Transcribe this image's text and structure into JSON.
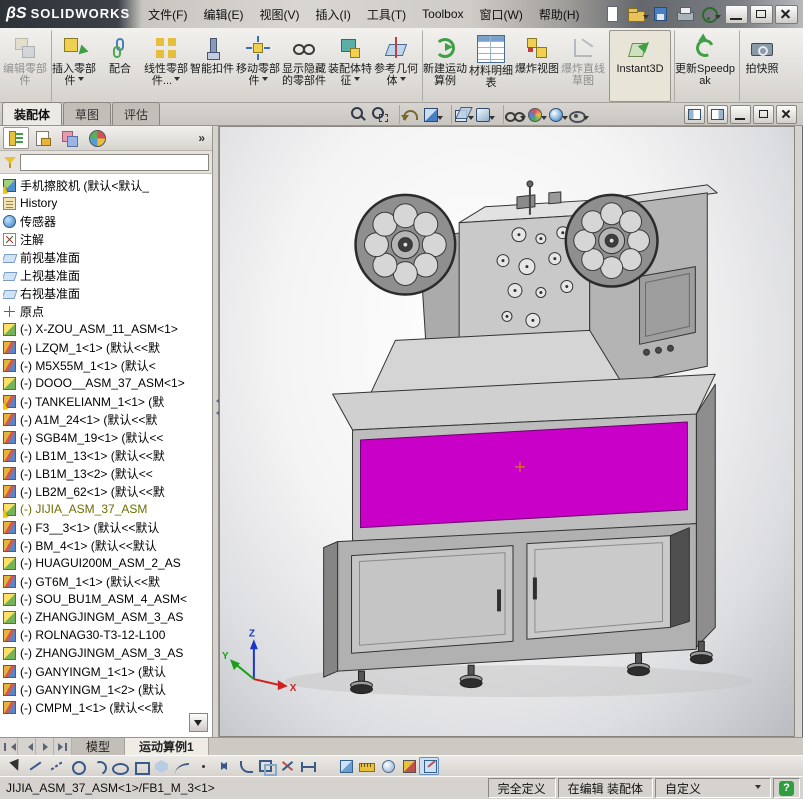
{
  "titlebar": {
    "logo_mark": "βS",
    "logo_text": "SOLIDWORKS",
    "menu": [
      {
        "label": "文件(F)"
      },
      {
        "label": "编辑(E)"
      },
      {
        "label": "视图(V)"
      },
      {
        "label": "插入(I)"
      },
      {
        "label": "工具(T)"
      },
      {
        "label": "Toolbox"
      },
      {
        "label": "窗口(W)"
      },
      {
        "label": "帮助(H)"
      }
    ],
    "quick_icons": [
      {
        "icon": "new-document"
      },
      {
        "icon": "open-document",
        "dd": true
      },
      {
        "icon": "save-document"
      },
      {
        "icon": "print-document"
      },
      {
        "icon": "help",
        "dd": true
      }
    ],
    "window_controls": [
      {
        "icon": "win-minimize"
      },
      {
        "icon": "win-restore"
      },
      {
        "icon": "win-close"
      }
    ]
  },
  "toolbar": {
    "buttons": [
      {
        "label": "编辑零部件",
        "icon": "edit-component",
        "disabled": true
      },
      {
        "label": "插入零部件",
        "icon": "insert-component",
        "dropdown": true,
        "sep": true
      },
      {
        "label": "配合",
        "icon": "mate"
      },
      {
        "label": "线性零部件...",
        "icon": "linear-pattern",
        "dropdown": true
      },
      {
        "label": "智能扣件",
        "icon": "smart-fasteners"
      },
      {
        "label": "移动零部件",
        "icon": "move-component",
        "dropdown": true
      },
      {
        "label": "显示隐藏的零部件",
        "icon": "show-hidden"
      },
      {
        "label": "装配体特征",
        "icon": "assembly-features",
        "dropdown": true
      },
      {
        "label": "参考几何体",
        "icon": "reference-geometry",
        "dropdown": true
      },
      {
        "label": "新建运动算例",
        "icon": "motion-study",
        "sep": true
      },
      {
        "label": "材料明细表",
        "icon": "bom"
      },
      {
        "label": "爆炸视图",
        "icon": "exploded-view"
      },
      {
        "label": "爆炸直线草图",
        "icon": "explode-sketch",
        "disabled": true
      },
      {
        "label": "Instant3D",
        "icon": "instant3d",
        "pressed": true,
        "sep": true,
        "wide": true
      },
      {
        "label": "更新Speedpak",
        "icon": "speedpak",
        "sep": true,
        "wide": true
      },
      {
        "label": "拍快照",
        "icon": "snapshot",
        "sep": true
      }
    ]
  },
  "command_tabs": [
    {
      "label": "装配体",
      "active": true
    },
    {
      "label": "草图"
    },
    {
      "label": "评估"
    }
  ],
  "viewbar": [
    {
      "icon": "zoom-fit"
    },
    {
      "icon": "zoom-area"
    },
    {
      "icon": "previous-view",
      "sep": true
    },
    {
      "icon": "section-view",
      "dd": true
    },
    {
      "icon": "view-orientation",
      "dd": true,
      "sep": true
    },
    {
      "icon": "display-style",
      "dd": true
    },
    {
      "icon": "hide-show",
      "dd": true,
      "sep": true
    },
    {
      "icon": "edit-appearance",
      "dd": true
    },
    {
      "icon": "apply-scene",
      "dd": true
    },
    {
      "icon": "view-settings",
      "dd": true
    }
  ],
  "doc_controls": [
    {
      "icon": "pane-left"
    },
    {
      "icon": "pane-right"
    },
    {
      "icon": "doc-minimize"
    },
    {
      "icon": "doc-restore"
    },
    {
      "icon": "doc-close"
    }
  ],
  "panel": {
    "tabs": [
      {
        "icon": "feature-manager",
        "active": true
      },
      {
        "icon": "property-manager"
      },
      {
        "icon": "configuration-manager"
      },
      {
        "icon": "display-manager"
      }
    ],
    "overflow": "»",
    "tree": [
      {
        "icon": "assembly-root",
        "warn": true,
        "label": "手机擦胶机 (默认<默认_"
      },
      {
        "icon": "history",
        "label": "History"
      },
      {
        "icon": "sensors",
        "label": "传感器"
      },
      {
        "icon": "annotations",
        "label": "注解"
      },
      {
        "icon": "plane",
        "label": "前视基准面"
      },
      {
        "icon": "plane",
        "label": "上视基准面"
      },
      {
        "icon": "plane",
        "label": "右视基准面"
      },
      {
        "icon": "origin",
        "label": "原点"
      },
      {
        "icon": "assembly",
        "label": "(-) X-ZOU_ASM_11_ASM<1>"
      },
      {
        "icon": "part",
        "label": "(-) LZQM_1<1> (默认<<默"
      },
      {
        "icon": "part",
        "label": "(-) M5X55M_1<1> (默认<"
      },
      {
        "icon": "assembly",
        "label": "(-) DOOO__ASM_37_ASM<1>"
      },
      {
        "icon": "part",
        "warn": true,
        "label": "(-) TANKELIANM_1<1> (默"
      },
      {
        "icon": "part",
        "label": "(-) A1M_24<1> (默认<<默"
      },
      {
        "icon": "part",
        "label": "(-) SGB4M_19<1> (默认<<"
      },
      {
        "icon": "part",
        "label": "(-) LB1M_13<1> (默认<<默"
      },
      {
        "icon": "part",
        "label": "(-) LB1M_13<2> (默认<<"
      },
      {
        "icon": "part",
        "label": "(-) LB2M_62<1> (默认<<默"
      },
      {
        "icon": "assembly",
        "warn": true,
        "edited": true,
        "label": "(-) JIJIA_ASM_37_ASM"
      },
      {
        "icon": "part",
        "label": "(-) F3__3<1> (默认<<默认"
      },
      {
        "icon": "part",
        "label": "(-) BM_4<1> (默认<<默认"
      },
      {
        "icon": "assembly",
        "label": "(-) HUAGUI200M_ASM_2_AS"
      },
      {
        "icon": "part",
        "label": "(-) GT6M_1<1> (默认<<默"
      },
      {
        "icon": "assembly",
        "label": "(-) SOU_BU1M_ASM_4_ASM<"
      },
      {
        "icon": "assembly",
        "label": "(-) ZHANGJINGM_ASM_3_AS"
      },
      {
        "icon": "part",
        "label": "(-) ROLNAG30-T3-12-L100"
      },
      {
        "icon": "assembly",
        "label": "(-) ZHANGJINGM_ASM_3_AS"
      },
      {
        "icon": "part",
        "label": "(-) GANYINGM_1<1> (默认"
      },
      {
        "icon": "part",
        "label": "(-) GANYINGM_1<2> (默认"
      },
      {
        "icon": "part",
        "label": "(-) CMPM_1<1> (默认<<默"
      }
    ]
  },
  "viewport": {
    "triad": {
      "x": "X",
      "y": "Y",
      "z": "Z"
    }
  },
  "model_tabs": {
    "tabs": [
      {
        "label": "模型"
      },
      {
        "label": "运动算例1",
        "active": true
      }
    ]
  },
  "sketchbar": [
    {
      "icon": "select"
    },
    {
      "icon": "line"
    },
    {
      "icon": "centerline"
    },
    {
      "icon": "circle"
    },
    {
      "icon": "arc"
    },
    {
      "icon": "ellipse"
    },
    {
      "icon": "rectangle"
    },
    {
      "icon": "polygon"
    },
    {
      "icon": "spline"
    },
    {
      "icon": "point"
    },
    {
      "icon": "mirror"
    },
    {
      "icon": "fillet"
    },
    {
      "icon": "offset"
    },
    {
      "icon": "trim"
    },
    {
      "icon": "dimension"
    },
    {
      "icon": "iso-cube",
      "sep": true
    },
    {
      "icon": "measure"
    },
    {
      "icon": "mass-properties"
    },
    {
      "icon": "section-tool"
    },
    {
      "icon": "sketch-mode",
      "pressed": true
    }
  ],
  "statusbar": {
    "selection": "JIJIA_ASM_37_ASM<1>/FB1_M_3<1>",
    "state": "完全定义",
    "editing": "在编辑 装配体",
    "custom": "自定义",
    "help": "?"
  }
}
